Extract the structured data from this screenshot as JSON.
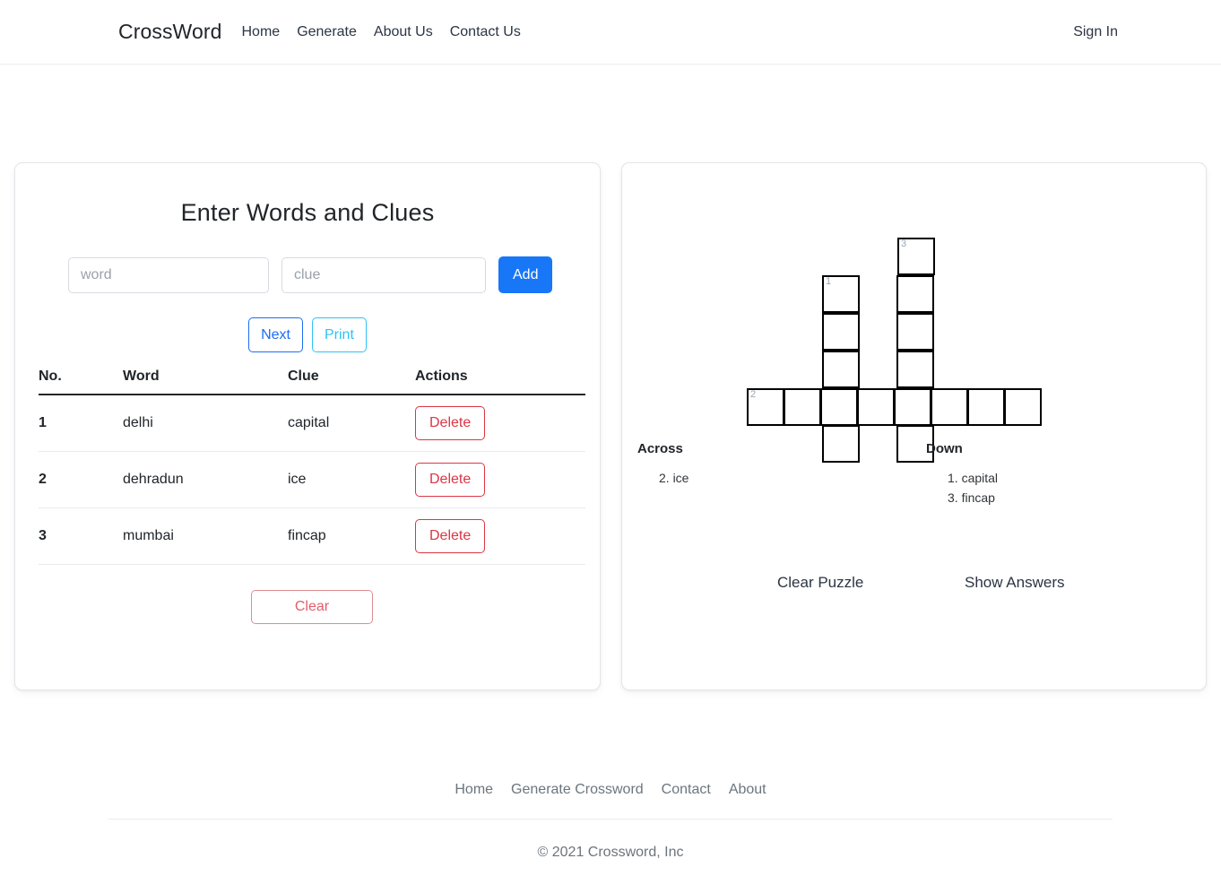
{
  "navbar": {
    "brand": "CrossWord",
    "links": [
      {
        "label": "Home"
      },
      {
        "label": "Generate"
      },
      {
        "label": "About Us"
      },
      {
        "label": "Contact Us"
      }
    ],
    "signin": "Sign In"
  },
  "entry_panel": {
    "title": "Enter Words and Clues",
    "word_placeholder": "word",
    "word_value": "",
    "clue_placeholder": "clue",
    "clue_value": "",
    "add_label": "Add",
    "next_label": "Next",
    "print_label": "Print",
    "clear_label": "Clear",
    "table": {
      "headers": [
        "No.",
        "Word",
        "Clue",
        "Actions"
      ],
      "rows": [
        {
          "no": "1",
          "word": "delhi",
          "clue": "capital",
          "action": "Delete"
        },
        {
          "no": "2",
          "word": "dehradun",
          "clue": "ice",
          "action": "Delete"
        },
        {
          "no": "3",
          "word": "mumbai",
          "clue": "fincap",
          "action": "Delete"
        }
      ]
    }
  },
  "crossword": {
    "cols": 8,
    "rows": 7,
    "cell_size": 42,
    "cells": [
      [
        0,
        0,
        0,
        0,
        0,
        0,
        0,
        0
      ],
      [
        0,
        0,
        0,
        0,
        1,
        0,
        0,
        0
      ],
      [
        0,
        0,
        1,
        0,
        1,
        0,
        0,
        0
      ],
      [
        0,
        0,
        1,
        0,
        1,
        0,
        0,
        0
      ],
      [
        0,
        0,
        1,
        0,
        1,
        0,
        0,
        0
      ],
      [
        1,
        1,
        1,
        1,
        1,
        1,
        1,
        1
      ],
      [
        0,
        0,
        1,
        0,
        1,
        0,
        0,
        0
      ]
    ],
    "numbers": [
      {
        "row": 1,
        "col": 4,
        "label": "3"
      },
      {
        "row": 2,
        "col": 2,
        "label": "1"
      },
      {
        "row": 5,
        "col": 0,
        "label": "2"
      }
    ],
    "letters": [],
    "across_heading": "Across",
    "down_heading": "Down",
    "across_clues": [
      {
        "num": "2.",
        "text": "ice"
      }
    ],
    "down_clues": [
      {
        "num": "1.",
        "text": "capital"
      },
      {
        "num": "3.",
        "text": "fincap"
      }
    ],
    "clear_puzzle_label": "Clear Puzzle",
    "show_answers_label": "Show Answers"
  },
  "footer": {
    "links": [
      {
        "label": "Home"
      },
      {
        "label": "Generate Crossword"
      },
      {
        "label": "Contact"
      },
      {
        "label": "About"
      }
    ],
    "copyright": "© 2021 Crossword, Inc"
  },
  "colors": {
    "primary": "#1877f7",
    "next_outline": "#1b6ef3",
    "print_outline": "#2ec2f5",
    "danger": "#dc3545",
    "clear_text": "#e35d6a",
    "muted": "#6c757d",
    "grid_line": "#000000",
    "grid_number": "#9aa6b2"
  }
}
